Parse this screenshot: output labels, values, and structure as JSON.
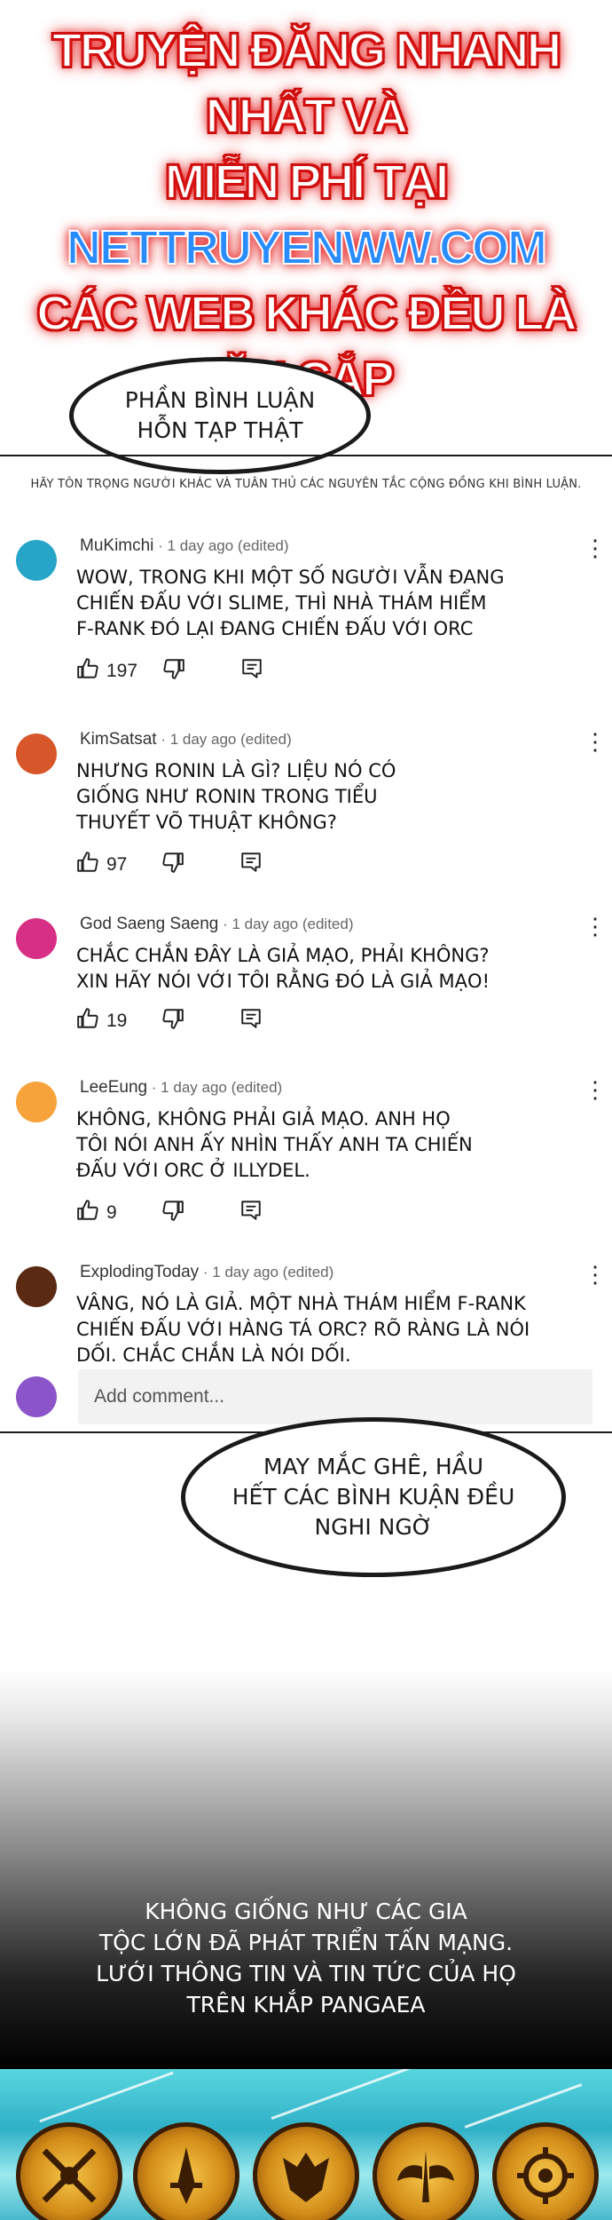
{
  "banner": {
    "line1": "TRUYỆN ĐĂNG NHANH NHẤT VÀ",
    "line2_prefix": "MIỄN PHÍ TẠI ",
    "line2_site": "NETTRUYENWW.COM",
    "line3": "CÁC WEB KHÁC ĐỀU LÀ ĂN CẮP"
  },
  "bubble_top": {
    "line1": "PHẦN BÌNH LUẬN",
    "line2": "HỖN TẠP THẬT"
  },
  "notice": "HÃY TÔN TRỌNG NGƯỜI KHÁC VÀ TUÂN THỦ CÁC NGUYÊN TẮC CỘNG ĐỒNG KHI BÌNH LUẬN.",
  "comments": [
    {
      "user": "MuKimchi",
      "meta": " · 1 day ago (edited)",
      "lines": [
        "WOW, TRONG KHI MỘT SỐ NGƯỜI VẪN ĐANG",
        "CHIẾN ĐẤU VỚI SLIME, THÌ NHÀ THÁM HIỂM",
        "F-RANK ĐÓ LẠI ĐANG CHIẾN ĐẤU VỚI ORC"
      ],
      "likes": "197",
      "avatar_color": "#26a5c8"
    },
    {
      "user": "KimSatsat",
      "meta": " · 1 day ago (edited)",
      "lines": [
        "NHƯNG RONIN LÀ GÌ? LIỆU NÓ CÓ",
        "GIỐNG NHƯ RONIN TRONG TIỂU",
        "THUYẾT VÕ THUẬT KHÔNG?"
      ],
      "likes": "97",
      "avatar_color": "#d8572a"
    },
    {
      "user": "God Saeng Saeng",
      "meta": " · 1 day ago (edited)",
      "lines": [
        "CHẮC CHẮN ĐÂY LÀ GIẢ MẠO, PHẢI KHÔNG?",
        "XIN HÃY NÓI VỚI TÔI RẰNG ĐÓ LÀ GIẢ MẠO!"
      ],
      "likes": "19",
      "avatar_color": "#d82f86"
    },
    {
      "user": "LeeEung",
      "meta": " · 1 day ago (edited)",
      "lines": [
        "KHÔNG, KHÔNG PHẢI GIẢ MẠO. ANH HỌ",
        "TÔI NÓI ANH ẤY NHÌN THẤY ANH TA CHIẾN",
        "ĐẤU VỚI ORC Ở ILLYDEL."
      ],
      "likes": "9",
      "avatar_color": "#f5a33a"
    },
    {
      "user": "ExplodingToday",
      "meta": " · 1 day ago (edited)",
      "lines": [
        "VÂNG, NÓ LÀ GIẢ. MỘT NHÀ THÁM HIỂM F-RANK",
        "CHIẾN ĐẤU VỚI HÀNG TÁ ORC? RÕ RÀNG LÀ NÓI",
        "DỐI. CHẮC CHẮN LÀ NÓI DỐI."
      ],
      "likes": "",
      "avatar_color": "#5a2a12"
    }
  ],
  "add_comment": {
    "placeholder": "Add comment...",
    "avatar_color": "#8b55c9"
  },
  "bubble_mid": {
    "line1": "MAY MẮC GHÊ, HẦU",
    "line2": "HẾT CÁC BÌNH KUẬN ĐỀU",
    "line3": "NGHI NGỜ"
  },
  "narration": {
    "line1": "KHÔNG GIỐNG NHƯ CÁC GIA",
    "line2": "TỘC LỚN ĐÃ PHÁT TRIỂN TẤN MẠNG.",
    "line3": "LƯỚI THÔNG TIN VÀ TIN TỨC CỦA HỌ",
    "line4": "TRÊN KHẮP PANGAEA"
  },
  "icons": {
    "like": "thumbs-up-icon",
    "dislike": "thumbs-down-icon",
    "reply": "reply-icon",
    "more": "more-vertical-icon"
  }
}
